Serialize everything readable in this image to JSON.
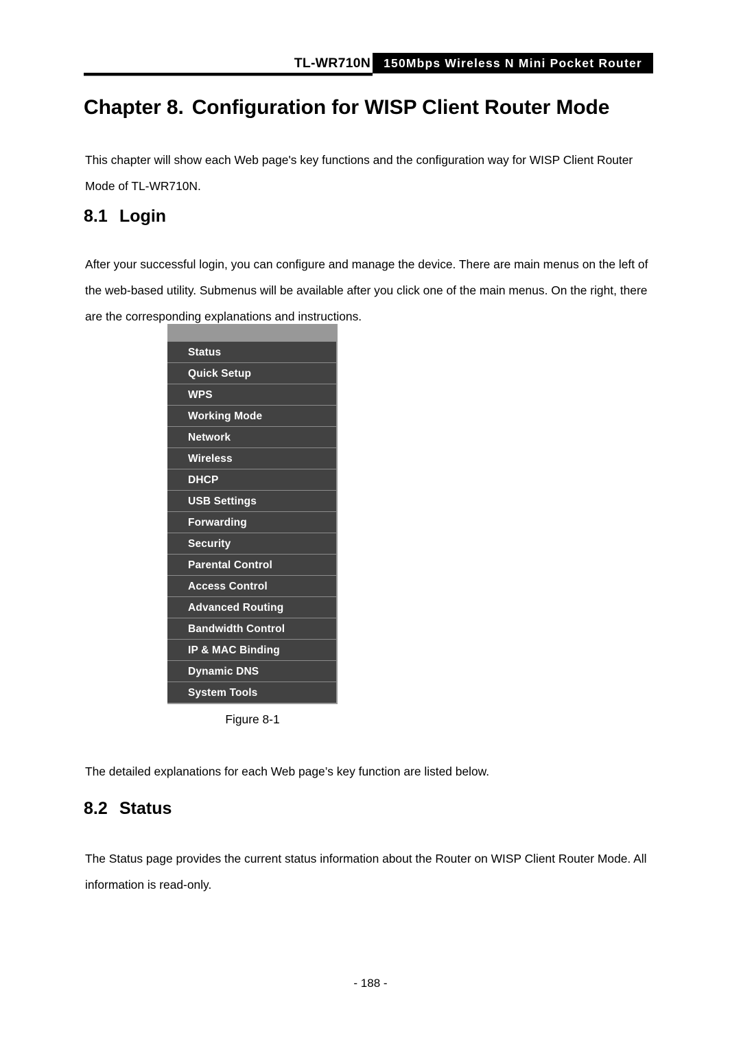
{
  "header": {
    "model": "TL-WR710N",
    "product_banner": "150Mbps Wireless N Mini Pocket Router"
  },
  "chapter": {
    "number_label": "Chapter 8.",
    "title": "Configuration for WISP Client Router Mode"
  },
  "intro_paragraph": "This chapter will show each Web page's key functions and the configuration way for WISP Client Router Mode of TL-WR710N.",
  "sections": {
    "login": {
      "number": "8.1",
      "title": "Login",
      "paragraph": "After your successful login, you can configure and manage the device. There are main menus on the left of the web-based utility. Submenus will be available after you click one of the main menus. On the right, there are the corresponding explanations and instructions.",
      "after_figure_paragraph": "The detailed explanations for each Web page’s key function are listed below."
    },
    "status": {
      "number": "8.2",
      "title": "Status",
      "paragraph": "The Status page provides the current status information about the Router on WISP Client Router Mode. All information is read-only."
    }
  },
  "figure": {
    "caption": "Figure 8-1",
    "menu_items": [
      "Status",
      "Quick Setup",
      "WPS",
      "Working Mode",
      "Network",
      "Wireless",
      "DHCP",
      "USB Settings",
      "Forwarding",
      "Security",
      "Parental Control",
      "Access Control",
      "Advanced Routing",
      "Bandwidth Control",
      "IP & MAC Binding",
      "Dynamic DNS",
      "System Tools"
    ],
    "colors": {
      "menu_background": "#424242",
      "menu_top_strip": "#989898",
      "separator": "#8d8d8d",
      "label_text": "#ffffff"
    }
  },
  "footer": {
    "page_number": "- 188 -"
  }
}
